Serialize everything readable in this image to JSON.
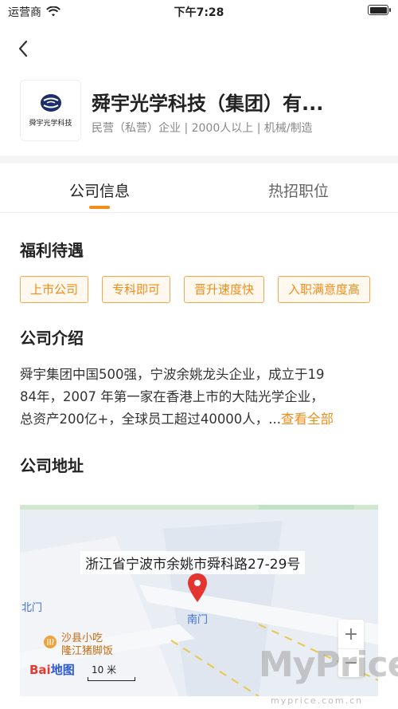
{
  "status_bar": {
    "carrier": "运营商",
    "time": "下午7:28"
  },
  "company": {
    "logo_text": "舜宇光学科技",
    "name": "舜宇光学科技（集团）有...",
    "meta": "民营（私营）企业 | 2000人以上 | 机械/制造"
  },
  "tabs": [
    {
      "label": "公司信息"
    },
    {
      "label": "热招职位"
    }
  ],
  "benefits": {
    "title": "福利待遇",
    "tags": [
      "上市公司",
      "专科即可",
      "晋升速度快",
      "入职满意度高"
    ]
  },
  "intro": {
    "title": "公司介绍",
    "lines": [
      "舜宇集团中国500强，宁波余姚龙头企业，成立于19",
      "84年，2007 年第一家在香港上市的大陆光学企业，",
      "总资产200亿+，全球员工超过40000人，..."
    ],
    "see_all": "查看全部"
  },
  "address": {
    "title": "公司地址",
    "map_label": "浙江省宁波市余姚市舜科路27-29号",
    "north_gate": "北门",
    "south_gate": "南门",
    "poi_line1": "沙县小吃",
    "poi_line2": "隆江猪脚饭",
    "baidu_b1": "Bai",
    "baidu_b2": "地图",
    "scale": "10 米",
    "zoom_in": "+",
    "zoom_out": "−"
  },
  "watermark": {
    "brand": "MyPrice",
    "url": "myprice.com.cn"
  },
  "colors": {
    "accent": "#f28c1a",
    "tag_border": "#f5a74f",
    "tag_bg": "#fff8ef",
    "map_pin": "#e3342f",
    "map_bg": "#e9eef5"
  }
}
